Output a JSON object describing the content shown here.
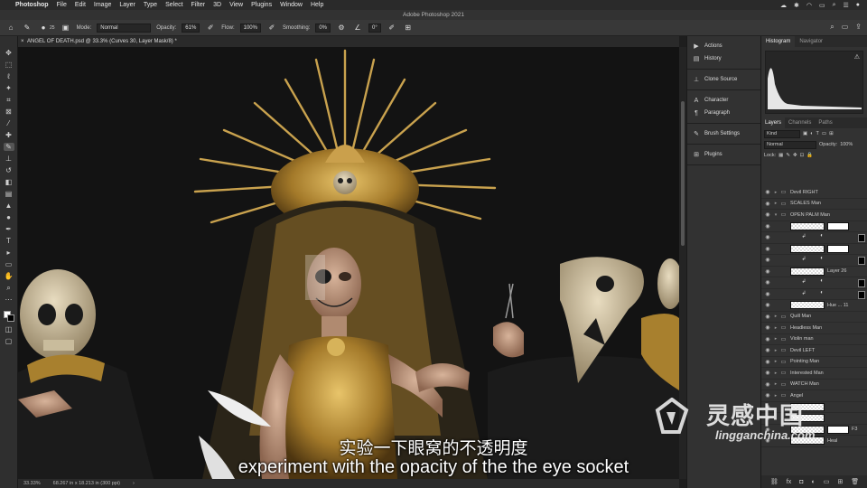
{
  "menubar": {
    "app": "Photoshop",
    "items": [
      "File",
      "Edit",
      "Image",
      "Layer",
      "Type",
      "Select",
      "Filter",
      "3D",
      "View",
      "Plugins",
      "Window",
      "Help"
    ]
  },
  "window": {
    "title": "Adobe Photoshop 2021"
  },
  "options": {
    "mode_label": "Mode:",
    "mode_value": "Normal",
    "opacity_label": "Opacity:",
    "opacity_value": "61%",
    "flow_label": "Flow:",
    "flow_value": "100%",
    "smoothing_label": "Smoothing:",
    "smoothing_value": "0%",
    "angle_value": "0°",
    "brush_size": "25"
  },
  "document": {
    "tab_title": "ANGEL OF DEATH.psd @ 33.3% (Curves 30, Layer Mask/8) *"
  },
  "status": {
    "zoom": "33.33%",
    "dimensions": "68.267 in x 18.213 in (300 ppi)"
  },
  "mid_panel": {
    "groups": [
      [
        "Actions",
        "History"
      ],
      [
        "Clone Source"
      ],
      [
        "Character",
        "Paragraph"
      ],
      [
        "Brush Settings"
      ],
      [
        "Plugins"
      ]
    ]
  },
  "right_panel": {
    "top_tabs": [
      "Histogram",
      "Navigator"
    ],
    "layer_tabs": [
      "Layers",
      "Channels",
      "Paths"
    ],
    "filter_kind": "Kind",
    "blend_mode": "Normal",
    "opacity_label": "Opacity:",
    "opacity_value": "100%",
    "lock_label": "Lock:",
    "layers": [
      {
        "type": "group",
        "name": "Devil RIGHT"
      },
      {
        "type": "group",
        "name": "SCALES Man"
      },
      {
        "type": "group-open",
        "name": "OPEN PALM Man"
      },
      {
        "type": "pixel-mask",
        "name": ""
      },
      {
        "type": "adjust",
        "name": ""
      },
      {
        "type": "pixel-mask",
        "name": ""
      },
      {
        "type": "adjust",
        "name": ""
      },
      {
        "type": "pixel",
        "name": "Layer 26"
      },
      {
        "type": "adjust",
        "name": ""
      },
      {
        "type": "adjust",
        "name": ""
      },
      {
        "type": "pixel",
        "name": "Hue ... 11"
      },
      {
        "type": "group",
        "name": "Quill Man"
      },
      {
        "type": "group",
        "name": "Headless Man"
      },
      {
        "type": "group",
        "name": "Violin man"
      },
      {
        "type": "group",
        "name": "Devil LEFT"
      },
      {
        "type": "group",
        "name": "Pointing Man"
      },
      {
        "type": "group",
        "name": "Interested Man"
      },
      {
        "type": "group",
        "name": "WATCH Man"
      },
      {
        "type": "group",
        "name": "Angel"
      },
      {
        "type": "pixel",
        "name": ""
      },
      {
        "type": "pixel",
        "name": ""
      },
      {
        "type": "pixel-mask",
        "name": "F3"
      },
      {
        "type": "pixel",
        "name": "Heal"
      }
    ]
  },
  "watermark": {
    "cn": "灵感中国",
    "en": "lingganchina.com"
  },
  "subtitles": {
    "cn": "实验一下眼窝的不透明度",
    "en": "experiment with the opacity of the the eye socket"
  }
}
